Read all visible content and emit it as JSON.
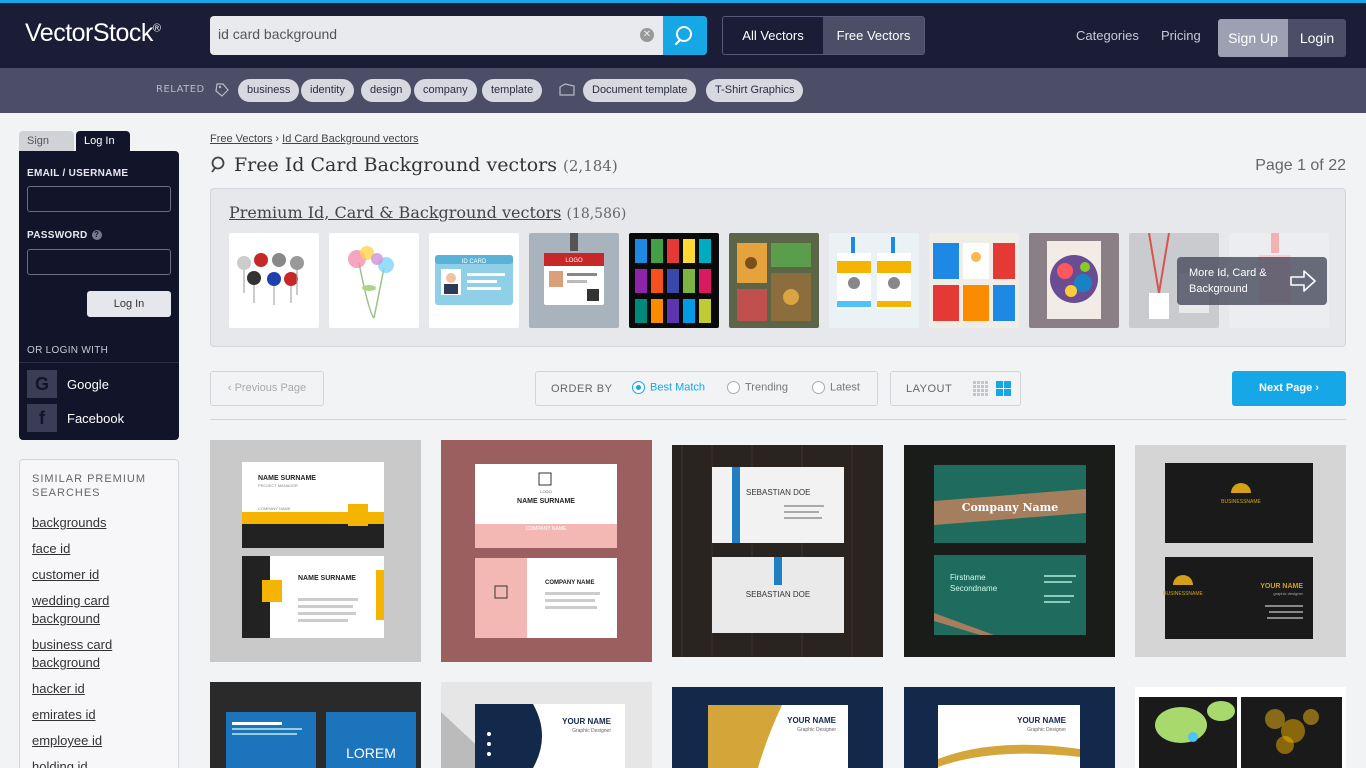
{
  "header": {
    "logo": "VectorStock",
    "logo_mark": "®",
    "search_value": "id card background",
    "tabs": [
      "All Vectors",
      "Free Vectors"
    ],
    "nav": [
      "Categories",
      "Pricing"
    ],
    "signup": "Sign Up",
    "login": "Login"
  },
  "related": {
    "label": "RELATED",
    "tags": [
      "business",
      "identity",
      "design",
      "company",
      "template"
    ],
    "tags2": [
      "Document template",
      "T-Shirt Graphics"
    ]
  },
  "sidebar": {
    "tab_signup": "Sign Up",
    "tab_login": "Log In",
    "email_label": "EMAIL / USERNAME",
    "password_label": "PASSWORD",
    "login_button": "Log In",
    "or_login": "OR LOGIN WITH",
    "social": [
      "Google",
      "Facebook"
    ],
    "similar_title": "SIMILAR PREMIUM SEARCHES",
    "similar": [
      "backgrounds",
      "face id",
      "customer id",
      "wedding card background",
      "business card background",
      "hacker id",
      "emirates id",
      "employee id",
      "holding id"
    ]
  },
  "main": {
    "breadcrumb": [
      "Free Vectors",
      "Id Card Background vectors"
    ],
    "breadcrumb_sep": "›",
    "title": "Free Id Card Background vectors",
    "title_count": "(2,184)",
    "page_label": "Page 1 of 22",
    "premium_title": "Premium Id, Card & Background vectors",
    "premium_count": "(18,586)",
    "more_label": "More Id, Card & Background",
    "prev": "Previous Page",
    "order_by": "ORDER BY",
    "order_options": [
      "Best Match",
      "Trending",
      "Latest"
    ],
    "layout": "LAYOUT",
    "next": "Next Page"
  },
  "cards": {
    "c1": [
      "NAME SURNAME",
      "PROJECT MANAGER",
      "COMPANY NAME"
    ],
    "c2": [
      "NAME SURNAME",
      "COMPANY NAME",
      "LOGO"
    ],
    "c3": [
      "SEBASTIAN DOE"
    ],
    "c4": [
      "Company Name",
      "Firstname",
      "Secondname"
    ],
    "c5": [
      "BUSINESSNAME",
      "YOUR NAME",
      "graphic designer"
    ],
    "c6": [
      "LOREM"
    ],
    "c7": [
      "YOUR NAME",
      "Graphic Designer"
    ],
    "thumb_id": "ID CARD",
    "thumb_logo": "LOGO"
  },
  "colors": {
    "accent": "#16a7e6",
    "header_bg": "#1b1d36",
    "related_bg": "#4b4e66"
  }
}
